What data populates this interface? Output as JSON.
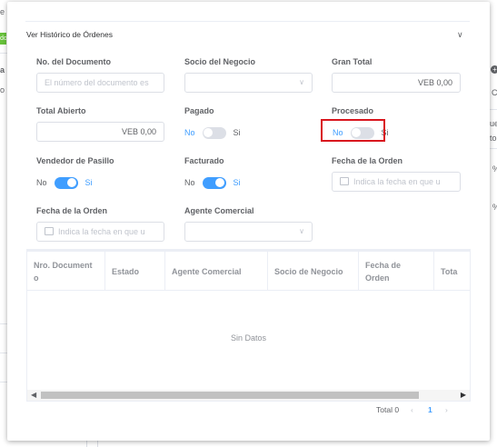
{
  "background": {
    "frag_e": "e",
    "frag_a": "a",
    "frag_o": "o",
    "frag_c": "C",
    "frag_ue": "ue",
    "frag_to": "to",
    "frag_pct1": "%",
    "frag_pct2": "%",
    "green_badge": "do"
  },
  "collapse": {
    "title": "Ver Histórico de Órdenes"
  },
  "form": {
    "nro_documento": {
      "label": "No. del Documento",
      "placeholder": "El número del documento es"
    },
    "socio_negocio": {
      "label": "Socio del Negocio",
      "value": ""
    },
    "gran_total": {
      "label": "Gran Total",
      "value": "VEB 0,00"
    },
    "total_abierto": {
      "label": "Total Abierto",
      "value": "VEB 0,00"
    },
    "pagado": {
      "label": "Pagado",
      "no": "No",
      "si": "Si",
      "on": false
    },
    "procesado": {
      "label": "Procesado",
      "no": "No",
      "si": "Si",
      "on": false
    },
    "vendedor_pasillo": {
      "label": "Vendedor de Pasillo",
      "no": "No",
      "si": "Si",
      "on": true
    },
    "facturado": {
      "label": "Facturado",
      "no": "No",
      "si": "Si",
      "on": true
    },
    "fecha_orden_1": {
      "label": "Fecha de la Orden",
      "placeholder": "Indica la fecha en que u"
    },
    "fecha_orden_2": {
      "label": "Fecha de la Orden",
      "placeholder": "Indica la fecha en que u"
    },
    "agente_comercial": {
      "label": "Agente Comercial",
      "value": ""
    }
  },
  "table": {
    "columns": [
      "Nro. Document o",
      "Estado",
      "Agente Comercial",
      "Socio de Negocio",
      "Fecha de Orden",
      "Tota"
    ],
    "empty_text": "Sin Datos"
  },
  "pagination": {
    "total": "Total 0",
    "current_page": "1"
  }
}
